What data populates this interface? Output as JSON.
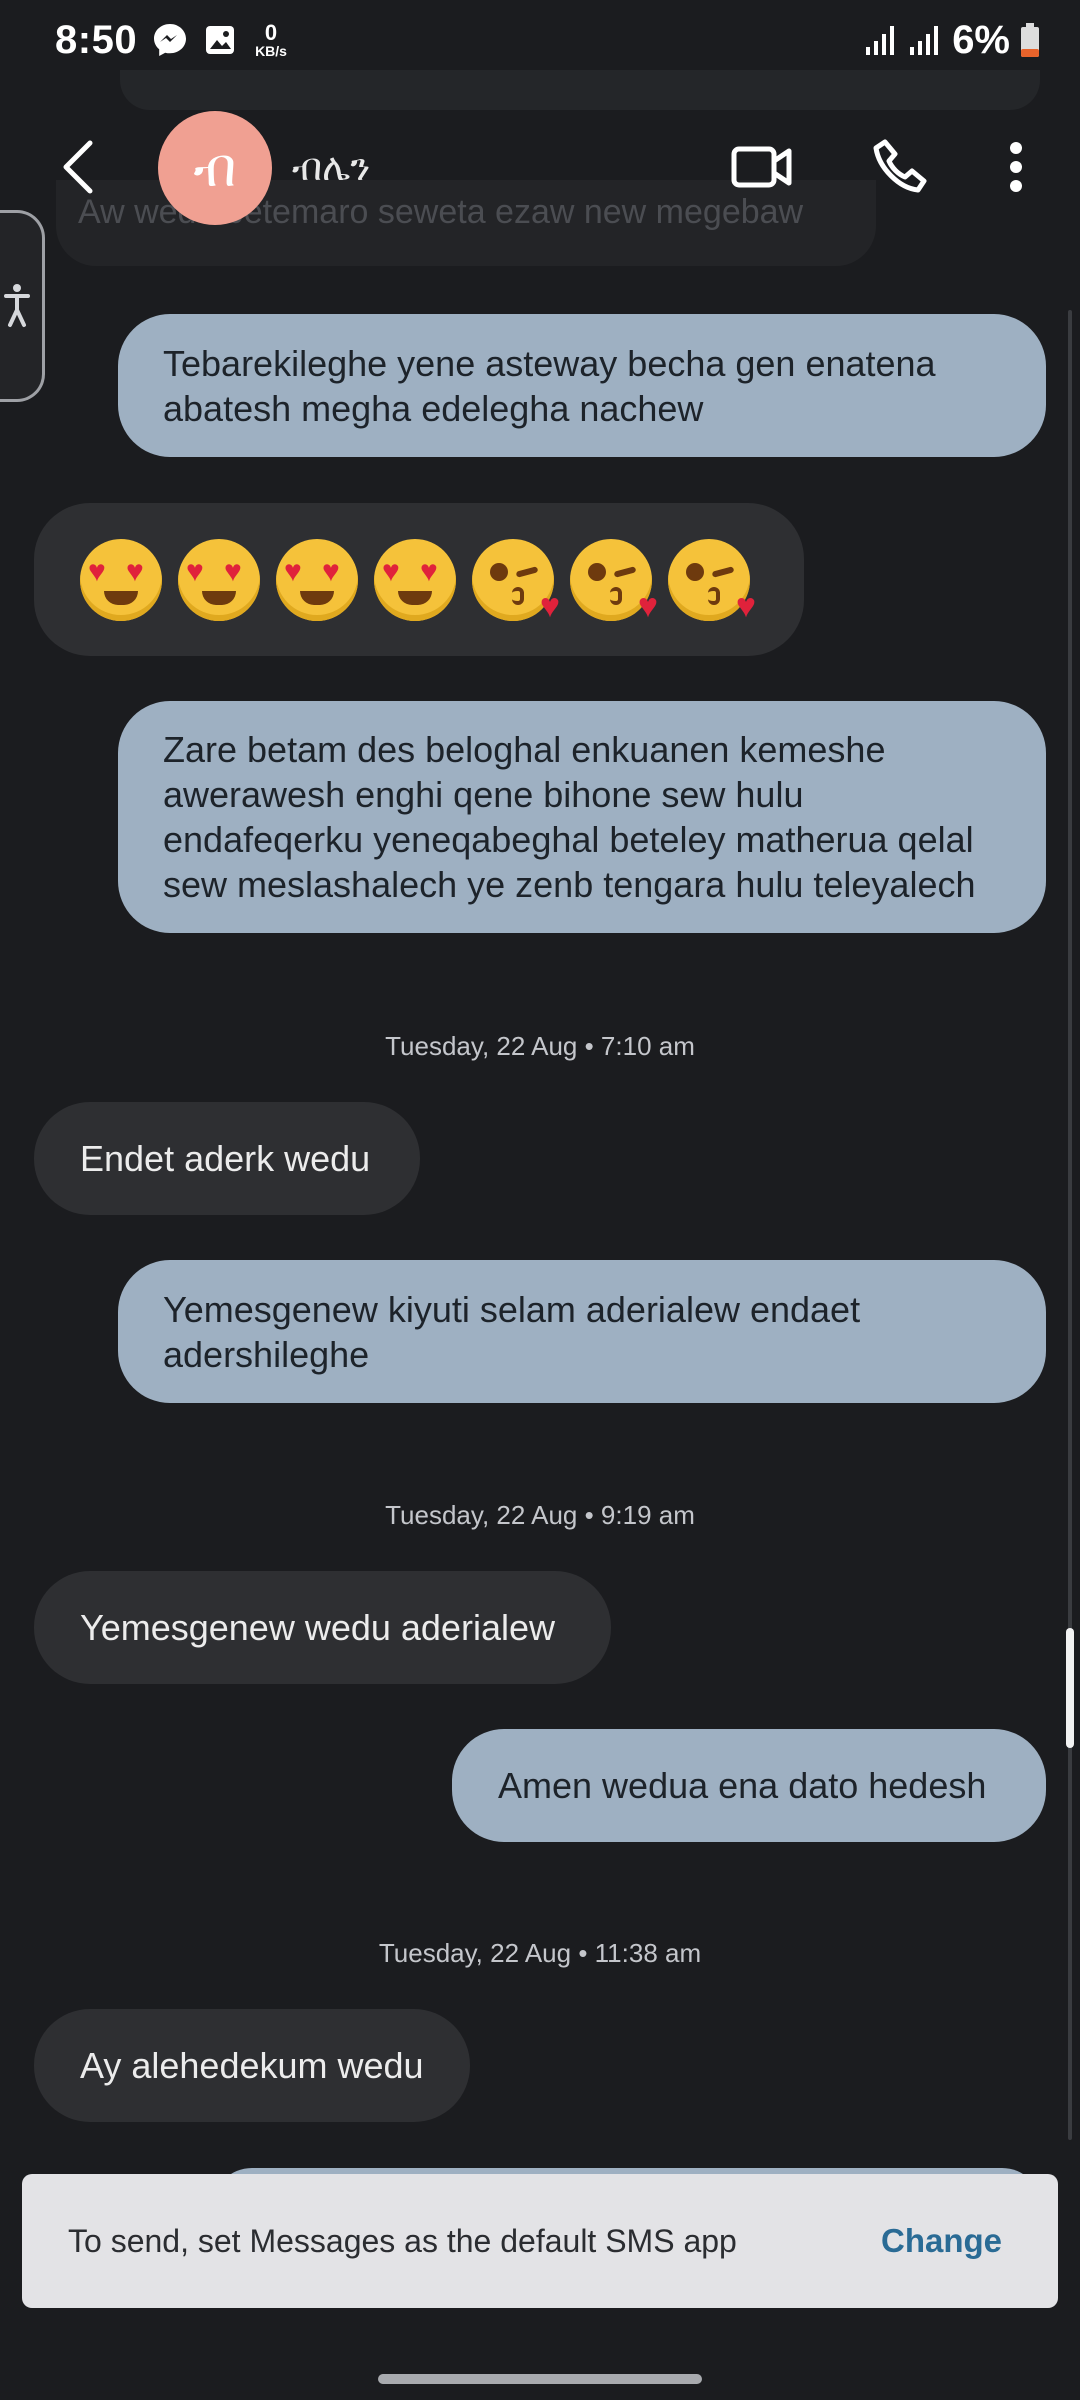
{
  "status_bar": {
    "time": "8:50",
    "netspeed_value": "0",
    "netspeed_unit": "KB/s",
    "battery": "6%"
  },
  "conversation": {
    "contact_name": "ብሌን",
    "avatar_letter": "ብ",
    "faded_previous_text": "Aw wedu betemaro seweta ezaw new megebaw"
  },
  "messages": [
    {
      "id": "m1",
      "direction": "out",
      "text": "Tebarekileghe yene asteway becha gen enatena abatesh megha edelegha nachew"
    },
    {
      "id": "m2",
      "direction": "in",
      "type": "emoji",
      "text": "😍😍😍😍😘😘😘"
    },
    {
      "id": "m3",
      "direction": "out",
      "text": "Zare betam des beloghal enkuanen kemeshe awerawesh enghi qene bihone sew hulu endafeqerku yeneqabeghal beteley matherua qelal sew meslashalech ye zenb tengara hulu teleyalech"
    },
    {
      "id": "d1",
      "type": "date",
      "text": "Tuesday, 22 Aug • 7:10 am"
    },
    {
      "id": "m4",
      "direction": "in",
      "text": "Endet aderk wedu"
    },
    {
      "id": "m5",
      "direction": "out",
      "text": "Yemesgenew kiyuti selam aderialew endaet adershileghe"
    },
    {
      "id": "d2",
      "type": "date",
      "text": "Tuesday, 22 Aug • 9:19 am"
    },
    {
      "id": "m6",
      "direction": "in",
      "text": "Yemesgenew wedu aderialew"
    },
    {
      "id": "m7",
      "direction": "out",
      "text": "Amen wedua ena dato hedesh"
    },
    {
      "id": "d3",
      "type": "date",
      "text": "Tuesday, 22 Aug • 11:38 am"
    },
    {
      "id": "m8",
      "direction": "in",
      "text": "Ay alehedekum wedu"
    }
  ],
  "snackbar": {
    "message": "To send, set Messages as the default SMS app",
    "action": "Change"
  },
  "colors": {
    "background": "#1b1c1f",
    "outgoing_bubble": "#9eb0c2",
    "incoming_bubble": "#2e2f32",
    "avatar": "#f0a092",
    "action_link": "#2a6b95"
  }
}
